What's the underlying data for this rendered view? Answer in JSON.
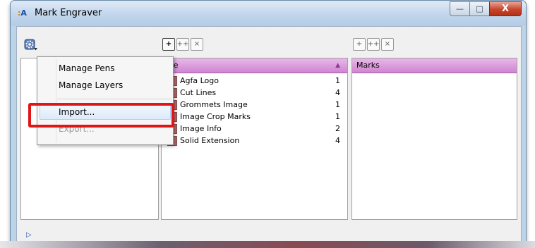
{
  "window": {
    "title": "Mark Engraver",
    "app_icon_text": "A",
    "controls": {
      "minimize": "—",
      "maximize": "□",
      "close": "X"
    }
  },
  "middle_toolbar": {
    "add": "+",
    "add_multiple": "++",
    "remove": "×"
  },
  "right_toolbar": {
    "add": "+",
    "add_multiple": "++",
    "remove": "×"
  },
  "layers_panel": {
    "header": "me",
    "sort_indicator": "▲",
    "rows": [
      {
        "name": "Agfa Logo",
        "count": "1"
      },
      {
        "name": "Cut Lines",
        "count": "4"
      },
      {
        "name": "Grommets Image",
        "count": "1"
      },
      {
        "name": "Image Crop Marks",
        "count": "1"
      },
      {
        "name": "Image Info",
        "count": "2"
      },
      {
        "name": "Solid Extension",
        "count": "4"
      }
    ]
  },
  "marks_panel": {
    "header": "Marks"
  },
  "expander": "▷",
  "context_menu": {
    "items": [
      {
        "label": "Manage Pens",
        "enabled": true
      },
      {
        "label": "Manage Layers",
        "enabled": true
      },
      {
        "label": "Import...",
        "enabled": true,
        "highlighted": true
      },
      {
        "label": "Export...",
        "enabled": false
      }
    ]
  },
  "colors": {
    "panel_header": "#cf85d1",
    "highlight_box": "#e01616",
    "close_button": "#c8452d"
  }
}
